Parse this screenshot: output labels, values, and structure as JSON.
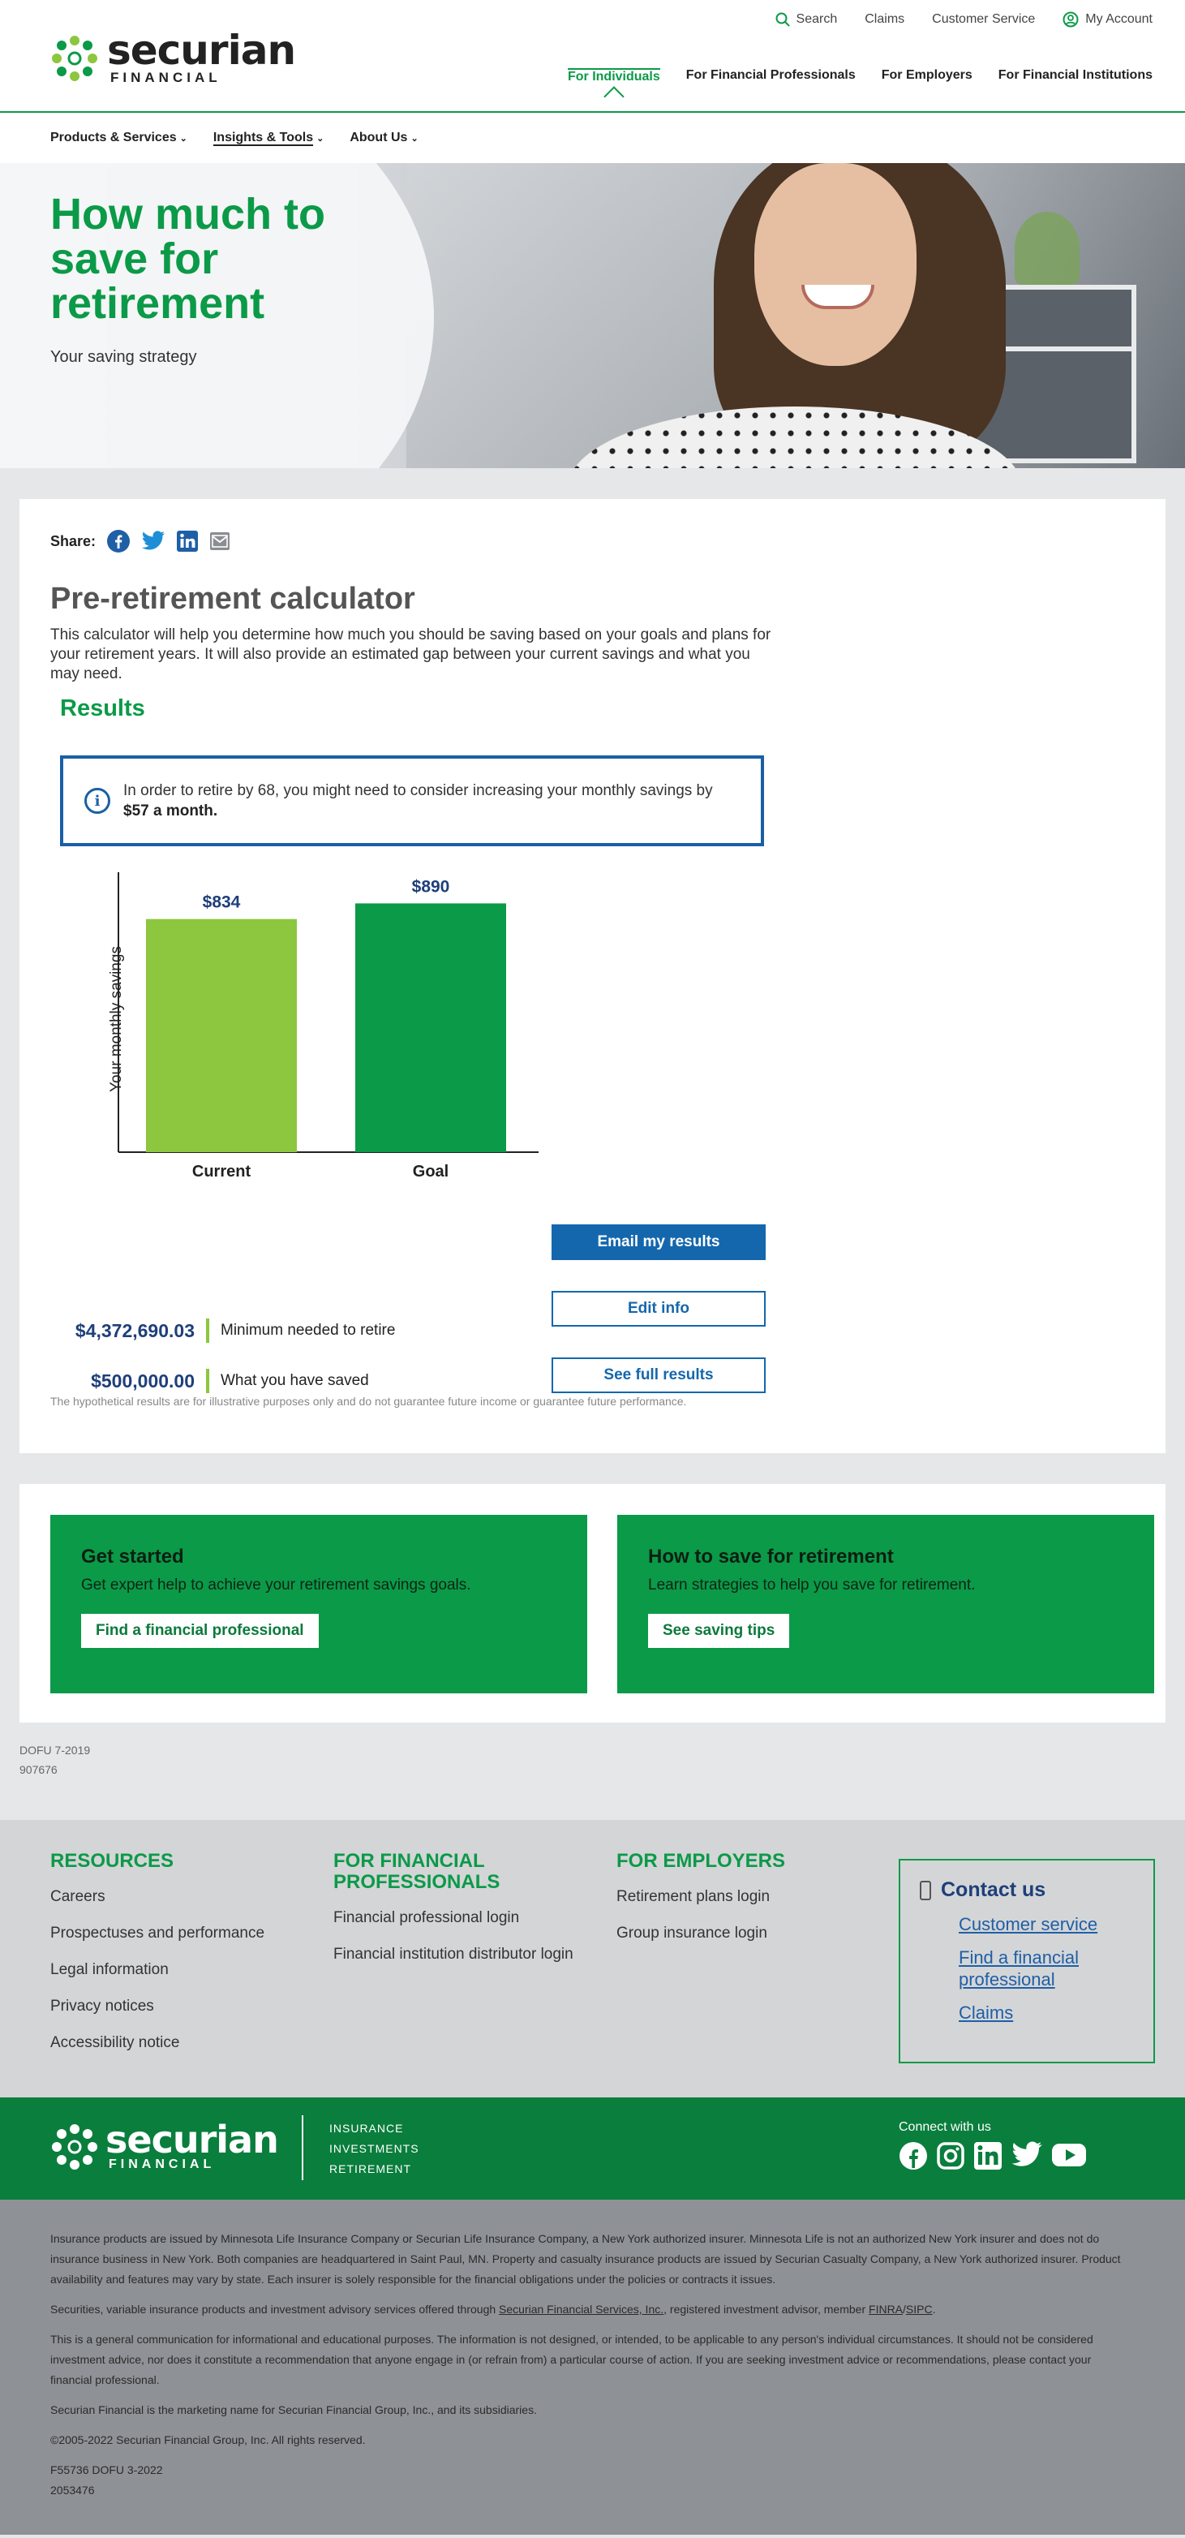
{
  "header": {
    "logo_word": "securian",
    "logo_sub": "FINANCIAL",
    "util_nav": {
      "search": "Search",
      "claims": "Claims",
      "service": "Customer Service",
      "account": "My Account"
    },
    "main_nav": [
      "For Individuals",
      "For Financial Professionals",
      "For Employers",
      "For Financial Institutions"
    ],
    "sub_nav": [
      "Products & Services",
      "Insights & Tools",
      "About Us"
    ]
  },
  "hero": {
    "title": "How much to save for retirement",
    "subtitle": "Your saving strategy"
  },
  "share": {
    "label": "Share:"
  },
  "calculator": {
    "title": "Pre-retirement calculator",
    "description": "This calculator will help you determine how much you should be saving based on your goals and plans for your retirement years. It will also provide an estimated gap between your current savings and what you may need.",
    "results_heading": "Results",
    "info_text": "In order to retire by 68, you might need to consider increasing your monthly savings by ",
    "info_bold": "$57 a month.",
    "stats": [
      {
        "value": "$4,372,690.03",
        "label": "Minimum needed to retire"
      },
      {
        "value": "$500,000.00",
        "label": "What you have saved"
      }
    ],
    "buttons": {
      "email": "Email my results",
      "edit": "Edit info",
      "full": "See full results"
    },
    "disclaimer": "The hypothetical results are for illustrative purposes only and do not guarantee future income or guarantee future performance."
  },
  "chart_data": {
    "type": "bar",
    "categories": [
      "Current",
      "Goal"
    ],
    "values": [
      834,
      890
    ],
    "value_labels": [
      "$834",
      "$890"
    ],
    "colors": [
      "#8dc63f",
      "#0b9a48"
    ],
    "ylabel": "Your monthly savings",
    "xlabel": "",
    "title": "",
    "grid": false
  },
  "cta": [
    {
      "title": "Get started",
      "text": "Get expert help to achieve your retirement savings goals.",
      "button": "Find a financial professional"
    },
    {
      "title": "How to save for retirement",
      "text": "Learn strategies to help you save for retirement.",
      "button": "See saving tips"
    }
  ],
  "dofu": {
    "line1": "DOFU 7-2019",
    "line2": "907676"
  },
  "footer": {
    "resources": {
      "title": "RESOURCES",
      "links": [
        "Careers",
        "Prospectuses and performance",
        "Legal information",
        "Privacy notices",
        "Accessibility notice"
      ]
    },
    "professionals": {
      "title": "FOR FINANCIAL PROFESSIONALS",
      "links": [
        "Financial professional login",
        "Financial institution distributor login"
      ]
    },
    "employers": {
      "title": "FOR EMPLOYERS",
      "links": [
        "Retirement plans login",
        "Group insurance login"
      ]
    },
    "contact": {
      "title": "Contact us",
      "links": [
        "Customer service",
        "Find a financial professional",
        "Claims"
      ]
    },
    "brand_tags": [
      "INSURANCE",
      "INVESTMENTS",
      "RETIREMENT"
    ],
    "connect": "Connect with us"
  },
  "legal": {
    "p1": "Insurance products are issued by Minnesota Life Insurance Company or Securian Life Insurance Company, a New York authorized insurer. Minnesota Life is not an authorized New York insurer and does not do insurance business in New York. Both companies are headquartered in Saint Paul, MN. Property and casualty insurance products are issued by Securian Casualty Company, a New York authorized insurer. Product availability and features may vary by state. Each insurer is solely responsible for the financial obligations under the policies or contracts it issues.",
    "p2_a": "Securities, variable insurance products and investment advisory services offered through ",
    "p2_link": "Securian Financial Services, Inc.",
    "p2_b": ", registered investment advisor, member ",
    "p2_finra": "FINRA",
    "p2_sep": "/",
    "p2_sipc": "SIPC",
    "p2_end": ".",
    "p3": "This is a general communication for informational and educational purposes. The information is not designed, or intended, to be applicable to any person's individual circumstances. It should not be considered investment advice, nor does it constitute a recommendation that anyone engage in (or refrain from) a particular course of action. If you are seeking investment advice or recommendations, please contact your financial professional.",
    "p4": "Securian Financial is the marketing name for Securian Financial Group, Inc., and its subsidiaries.",
    "p5": "©2005-2022 Securian Financial Group, Inc. All rights reserved.",
    "p6a": "F55736 DOFU 3-2022",
    "p6b": "2053476"
  }
}
